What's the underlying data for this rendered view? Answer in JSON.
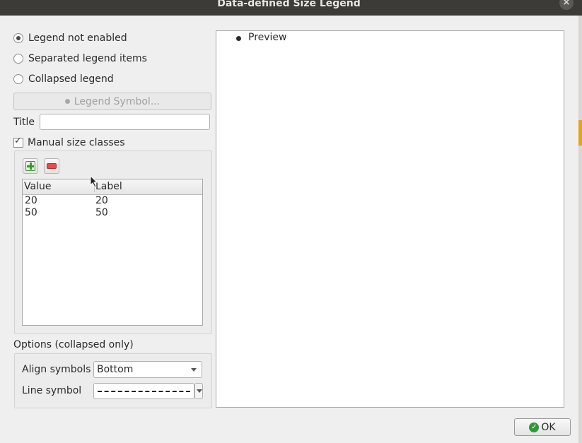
{
  "window": {
    "title": "Data-defined Size Legend",
    "close_symbol": "×"
  },
  "legend_mode": {
    "options": [
      "Legend not enabled",
      "Separated legend items",
      "Collapsed legend"
    ],
    "selected": "Legend not enabled"
  },
  "legend_symbol_button": {
    "label": "Legend Symbol..."
  },
  "title_field": {
    "label": "Title",
    "value": ""
  },
  "manual_size_classes": {
    "label": "Manual size classes",
    "checked": true
  },
  "size_classes_table": {
    "headers": [
      "Value",
      "Label"
    ],
    "rows": [
      {
        "value": "20",
        "label": "20"
      },
      {
        "value": "50",
        "label": "50"
      }
    ]
  },
  "options_section": {
    "title": "Options (collapsed only)",
    "align_symbols": {
      "label": "Align symbols",
      "value": "Bottom"
    },
    "line_symbol": {
      "label": "Line symbol"
    }
  },
  "preview": {
    "item": "Preview"
  },
  "ok_button": {
    "label": "OK"
  },
  "colors": {
    "title_bar": "#3c3b37",
    "add_icon": "#3a9a2a",
    "remove_icon": "#e84a4a",
    "ok_icon": "#2f9a3a"
  },
  "icons": [
    "close-icon",
    "add-icon",
    "remove-icon",
    "dropdown-arrow-icon",
    "ok-check-icon",
    "mouse-cursor-icon"
  ]
}
